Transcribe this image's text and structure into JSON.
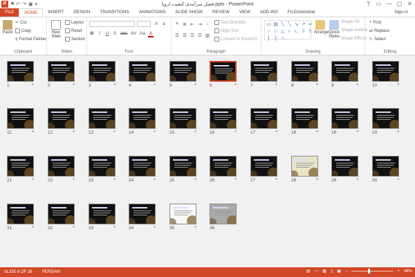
{
  "window": {
    "title": "فصل سرآمدی کیفیت اروپا.pptx - PowerPoint",
    "controls": [
      "?",
      "▭",
      "—",
      "▢",
      "✕"
    ]
  },
  "tabs": [
    "FILE",
    "HOME",
    "INSERT",
    "DESIGN",
    "TRANSITIONS",
    "ANIMATIONS",
    "SLIDE SHOW",
    "REVIEW",
    "VIEW",
    "ADD-INS",
    "FILEminimizer"
  ],
  "signin": "Sign in",
  "ribbon": {
    "clipboard": {
      "paste": "Paste",
      "cut": "Cut",
      "copy": "Copy",
      "format_painter": "Format Painter",
      "label": "Clipboard"
    },
    "slides": {
      "new_slide": "New Slide",
      "layout": "Layout",
      "reset": "Reset",
      "section": "Section",
      "label": "Slides"
    },
    "font": {
      "label": "Font",
      "format_glyphs": [
        "B",
        "I",
        "U",
        "S",
        "abc",
        "AV",
        "Aa",
        "A"
      ]
    },
    "paragraph": {
      "text_direction": "Text Direction",
      "align_text": "Align Text",
      "convert_smartart": "Convert to SmartArt",
      "label": "Paragraph"
    },
    "drawing": {
      "arrange": "Arrange",
      "quick_styles": "Quick Styles",
      "shape_fill": "Shape Fill",
      "shape_outline": "Shape Outline",
      "shape_effects": "Shape Effects",
      "label": "Drawing"
    },
    "editing": {
      "find": "Find",
      "replace": "Replace",
      "select": "Select",
      "label": "Editing"
    }
  },
  "slides": [
    {
      "num": "1"
    },
    {
      "num": "2"
    },
    {
      "num": "3"
    },
    {
      "num": "4"
    },
    {
      "num": "5"
    },
    {
      "num": "6"
    },
    {
      "num": "7"
    },
    {
      "num": "8"
    },
    {
      "num": "9"
    },
    {
      "num": "10"
    },
    {
      "num": "11"
    },
    {
      "num": "12"
    },
    {
      "num": "13"
    },
    {
      "num": "14"
    },
    {
      "num": "15"
    },
    {
      "num": "16"
    },
    {
      "num": "17"
    },
    {
      "num": "18"
    },
    {
      "num": "19"
    },
    {
      "num": "20"
    },
    {
      "num": "21"
    },
    {
      "num": "22"
    },
    {
      "num": "23"
    },
    {
      "num": "24"
    },
    {
      "num": "25"
    },
    {
      "num": "26"
    },
    {
      "num": "27"
    },
    {
      "num": "28"
    },
    {
      "num": "29"
    },
    {
      "num": "30"
    },
    {
      "num": "31"
    },
    {
      "num": "32"
    },
    {
      "num": "33"
    },
    {
      "num": "34"
    },
    {
      "num": "35"
    },
    {
      "num": "36"
    }
  ],
  "selected_slide": "6",
  "status": {
    "slide_info": "SLIDE 6 OF 36",
    "language": "PERSIAN",
    "zoom": "48%"
  },
  "colors": {
    "accent": "#d24726"
  }
}
